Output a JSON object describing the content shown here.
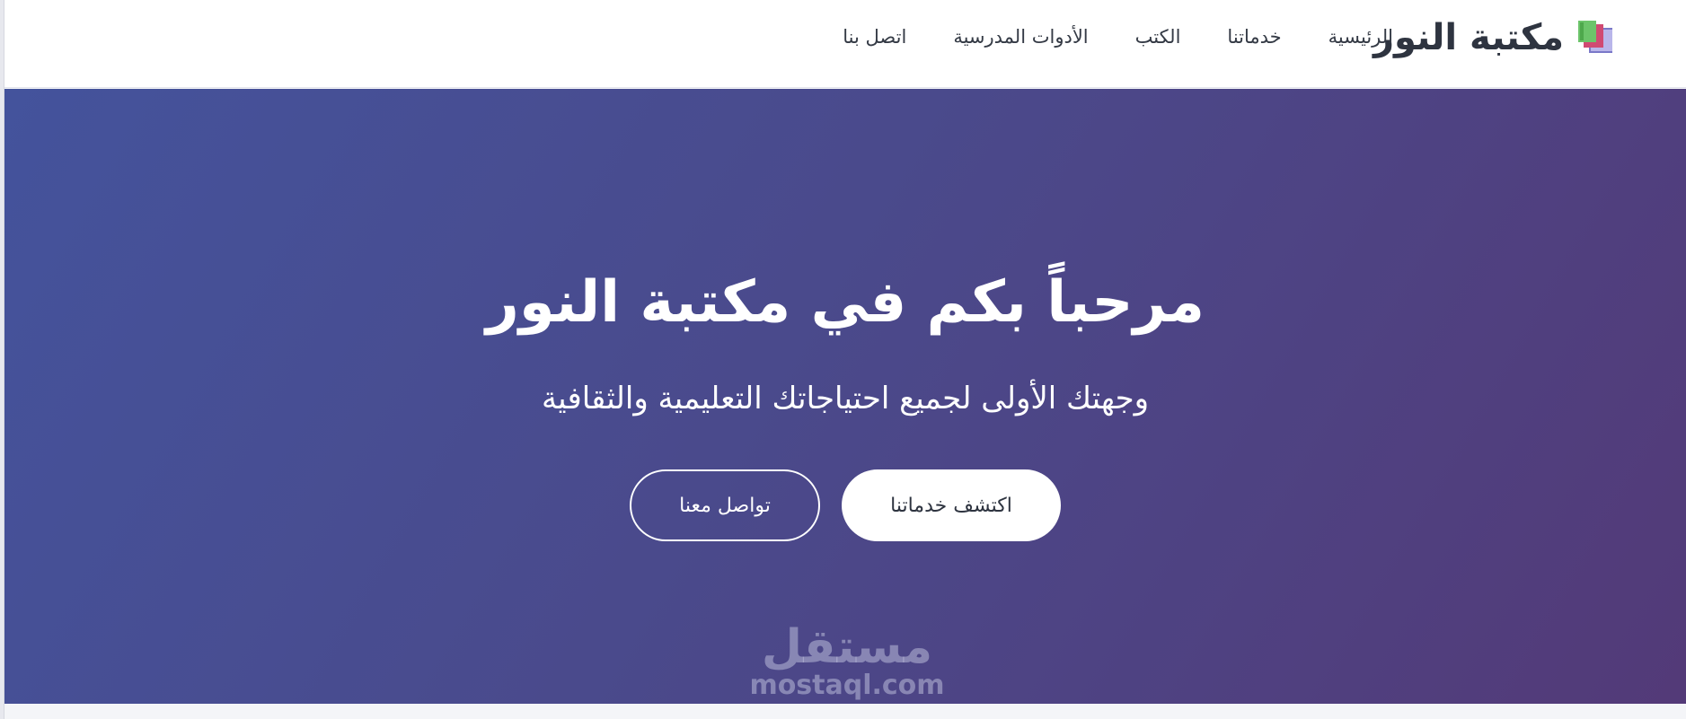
{
  "header": {
    "brand": "مكتبة النور",
    "brand_icon": "books-icon",
    "nav": [
      {
        "label": "الرئيسية"
      },
      {
        "label": "خدماتنا"
      },
      {
        "label": "الكتب"
      },
      {
        "label": "الأدوات المدرسية"
      },
      {
        "label": "اتصل بنا"
      }
    ]
  },
  "hero": {
    "title": "مرحباً بكم في مكتبة النور",
    "subtitle": "وجهتك الأولى لجميع احتياجاتك التعليمية والثقافية",
    "primary_button": "اكتشف خدماتنا",
    "secondary_button": "تواصل معنا"
  },
  "watermark": {
    "logo": "مستقل",
    "url": "mostaql.com"
  },
  "colors": {
    "hero_start": "#44539c",
    "hero_end": "#533a78",
    "text_dark": "#2e3440",
    "white": "#ffffff"
  }
}
